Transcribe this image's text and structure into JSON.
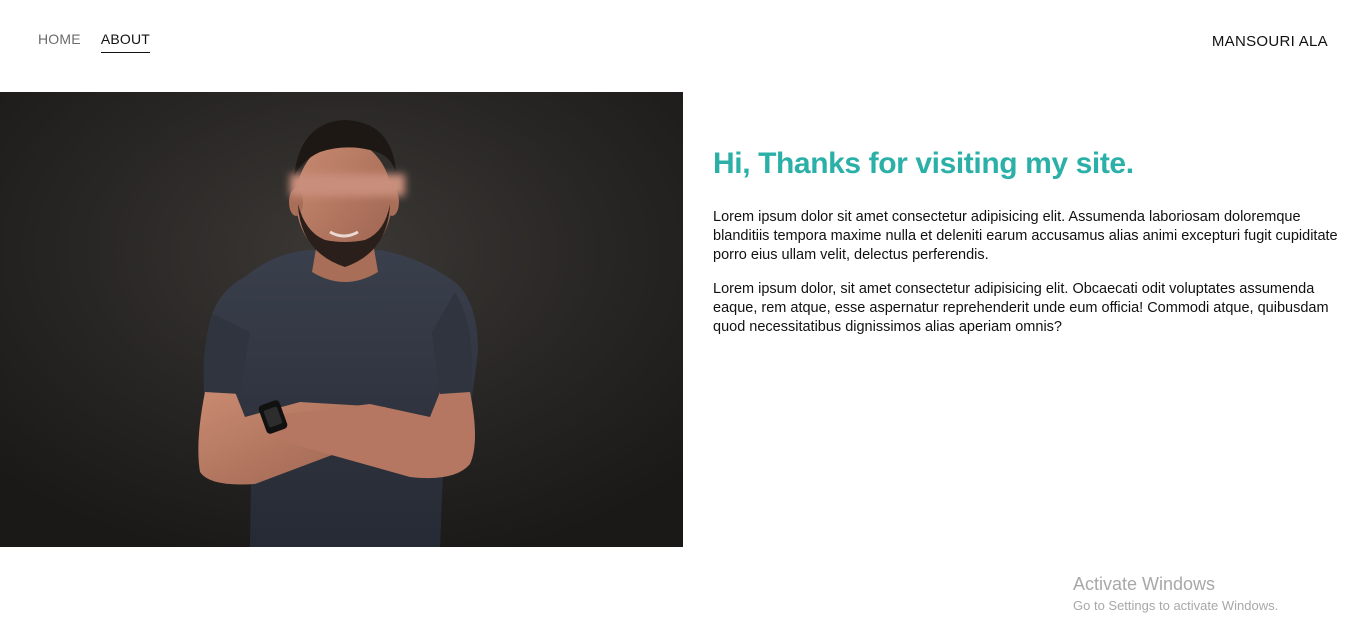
{
  "nav": {
    "home_label": "HOME",
    "about_label": "ABOUT",
    "active": "about"
  },
  "brand": {
    "name": "MANSOURI ALA"
  },
  "hero": {
    "image_icon": "portrait-photo",
    "heading": "Hi, Thanks for visiting my site.",
    "paragraph_1": "Lorem ipsum dolor sit amet consectetur adipisicing elit. Assumenda laboriosam doloremque blanditiis tempora maxime nulla et deleniti earum accusamus alias animi excepturi fugit cupiditate porro eius ullam velit, delectus perferendis.",
    "paragraph_2": "Lorem ipsum dolor, sit amet consectetur adipisicing elit. Obcaecati odit voluptates assumenda eaque, rem atque, esse aspernatur reprehenderit unde eum officia! Commodi atque, quibusdam quod necessitatibus dignissimos alias aperiam omnis?"
  },
  "watermark": {
    "title": "Activate Windows",
    "subtitle": "Go to Settings to activate Windows."
  },
  "colors": {
    "accent": "#2bb0a8",
    "text": "#111111",
    "nav_inactive": "#6b6b6b",
    "photo_bg": "#2a2826"
  }
}
